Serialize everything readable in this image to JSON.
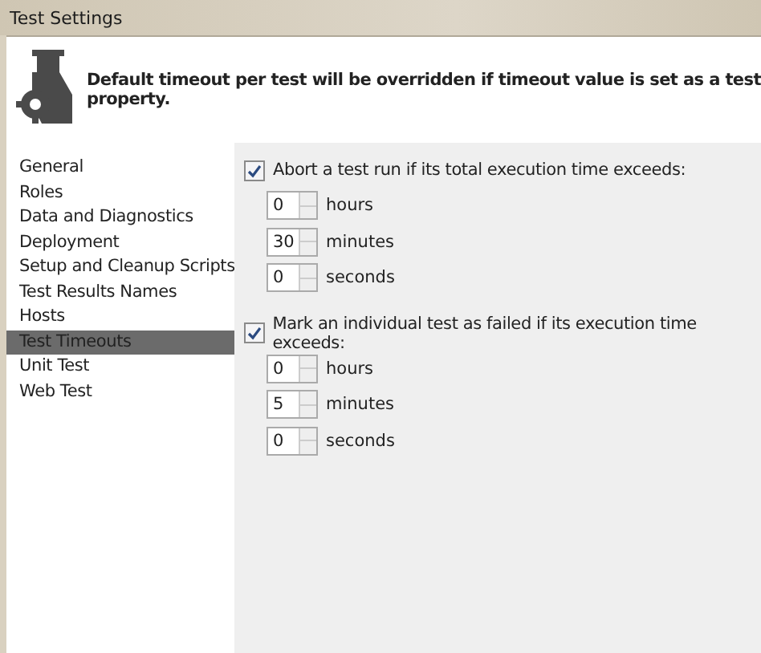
{
  "window": {
    "title": "Test Settings"
  },
  "header": {
    "message": "Default timeout per test will be overridden if timeout value is set as a test property."
  },
  "sidebar": {
    "items": [
      {
        "label": "General",
        "selected": false
      },
      {
        "label": "Roles",
        "selected": false
      },
      {
        "label": "Data and Diagnostics",
        "selected": false
      },
      {
        "label": "Deployment",
        "selected": false
      },
      {
        "label": "Setup and Cleanup Scripts",
        "selected": false
      },
      {
        "label": "Test Results Names",
        "selected": false
      },
      {
        "label": "Hosts",
        "selected": false
      },
      {
        "label": "Test Timeouts",
        "selected": true
      },
      {
        "label": "Unit Test",
        "selected": false
      },
      {
        "label": "Web Test",
        "selected": false
      }
    ]
  },
  "groups": [
    {
      "label": "Abort a test run if its total execution time exceeds:",
      "checked": true,
      "fields": [
        {
          "value": "0",
          "unit": "hours"
        },
        {
          "value": "30",
          "unit": "minutes"
        },
        {
          "value": "0",
          "unit": "seconds"
        }
      ]
    },
    {
      "label": "Mark an individual test as failed if its execution time exceeds:",
      "checked": true,
      "fields": [
        {
          "value": "0",
          "unit": "hours"
        },
        {
          "value": "5",
          "unit": "minutes"
        },
        {
          "value": "0",
          "unit": "seconds"
        }
      ]
    }
  ]
}
